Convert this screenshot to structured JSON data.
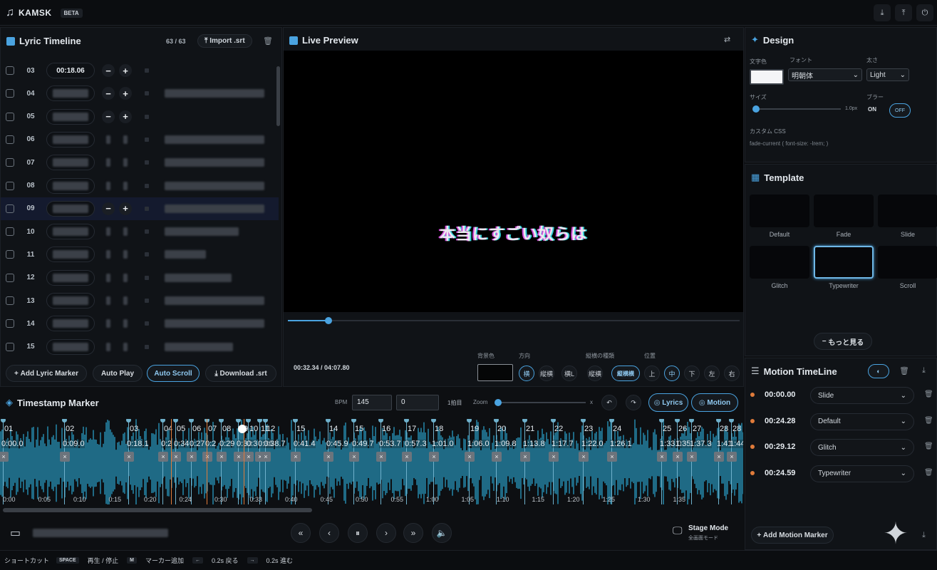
{
  "app": {
    "name": "KAMSK",
    "badge": "BETA"
  },
  "lyric_panel": {
    "title": "Lyric Timeline",
    "count": "63 / 63",
    "import_label": "Import .srt",
    "rows": [
      {
        "num": "03",
        "time": "00:18.06",
        "selected": false
      },
      {
        "num": "04",
        "time": "",
        "selected": false
      },
      {
        "num": "05",
        "time": "",
        "selected": false
      },
      {
        "num": "06",
        "time": "",
        "selected": false
      },
      {
        "num": "07",
        "time": "",
        "selected": false
      },
      {
        "num": "08",
        "time": "",
        "selected": false
      },
      {
        "num": "09",
        "time": "",
        "selected": true
      },
      {
        "num": "10",
        "time": "",
        "selected": false
      },
      {
        "num": "11",
        "time": "",
        "selected": false
      },
      {
        "num": "12",
        "time": "",
        "selected": false
      },
      {
        "num": "13",
        "time": "",
        "selected": false
      },
      {
        "num": "14",
        "time": "",
        "selected": false
      },
      {
        "num": "15",
        "time": "",
        "selected": false
      }
    ],
    "buttons": {
      "add": "Add Lyric Marker",
      "autoplay": "Auto Play",
      "autoscroll": "Auto Scroll",
      "download": "Download .srt"
    }
  },
  "preview": {
    "title": "Live Preview",
    "lyric": "本当にすごい奴らは",
    "time": "00:32.34 / 04:07.80",
    "labels": {
      "bg": "背景色",
      "direction": "方向",
      "transition": "縦横の種類",
      "position": "位置"
    },
    "dir_buttons": [
      "横",
      "縦横",
      "横L",
      "縦横"
    ],
    "trans_label": "縦横1",
    "trans_options": [
      "縦横横"
    ],
    "pos_buttons": [
      "上",
      "中",
      "下",
      "左",
      "右"
    ],
    "progress": 0.09
  },
  "design": {
    "title": "Design",
    "labels": {
      "color": "文字色",
      "font": "フォント",
      "weight": "太さ",
      "size": "サイズ",
      "blur": "ブラー",
      "css": "カスタム CSS"
    },
    "font_value": "明朝体",
    "weight_value": "Light",
    "size_unit": "1.0px",
    "blur_on": "ON",
    "blur_off": "OFF",
    "css_placeholder": "fade-current ( font-size: -lrem; )"
  },
  "template": {
    "title": "Template",
    "items": [
      "Default",
      "Fade",
      "Slide",
      "Glitch",
      "Typewriter",
      "Scroll"
    ],
    "selected": 4,
    "more": "もっと見る"
  },
  "motion": {
    "title": "Motion TimeLine",
    "rows": [
      {
        "time": "00:00.00",
        "effect": "Slide"
      },
      {
        "time": "00:24.28",
        "effect": "Default"
      },
      {
        "time": "00:29.12",
        "effect": "Glitch"
      },
      {
        "time": "00:24.59",
        "effect": "Typewriter"
      }
    ],
    "add": "Add Motion Marker"
  },
  "timestamp": {
    "title": "Timestamp Marker",
    "bpm_label": "BPM",
    "bpm": "145",
    "offset": "0",
    "beat_label": "1拍目",
    "zoom_label": "Zoom",
    "zoom_unit": "x",
    "lyrics_btn": "Lyrics",
    "motion_btn": "Motion",
    "markers": [
      {
        "label": "01",
        "time": "0:00.0"
      },
      {
        "label": "02",
        "time": "0:09.0"
      },
      {
        "label": "03",
        "time": "0:18.1"
      },
      {
        "label": "04",
        "time": "0:2"
      },
      {
        "label": "05",
        "time": "0:34"
      },
      {
        "label": "06",
        "time": "0:27"
      },
      {
        "label": "07",
        "time": "0:2"
      },
      {
        "label": "08",
        "time": "0:29"
      },
      {
        "label": "09",
        "time": "0:30"
      },
      {
        "label": "10",
        "time": "0:3"
      },
      {
        "label": "11",
        "time": "0:36"
      },
      {
        "label": "12",
        "time": "0:38.7"
      },
      {
        "label": "15",
        "time": "0:41.4"
      },
      {
        "label": "14",
        "time": "0:45.9"
      },
      {
        "label": "15",
        "time": "0:49.7"
      },
      {
        "label": "16",
        "time": "0:53.7"
      },
      {
        "label": "17",
        "time": "0:57.3"
      },
      {
        "label": "18",
        "time": "1:01.0"
      },
      {
        "label": "19",
        "time": "1:06.0"
      },
      {
        "label": "20",
        "time": "1:09.8"
      },
      {
        "label": "21",
        "time": "1:13.8"
      },
      {
        "label": "22",
        "time": "1:17.7"
      },
      {
        "label": "23",
        "time": "1:22.0"
      },
      {
        "label": "24",
        "time": "1:26.1"
      },
      {
        "label": "25",
        "time": "1:33.0"
      },
      {
        "label": "26",
        "time": "1:35"
      },
      {
        "label": "27",
        "time": "1:37.3"
      },
      {
        "label": "28",
        "time": "1:41"
      },
      {
        "label": "28",
        "time": "1:44"
      }
    ],
    "ticks": [
      "0:00",
      "0:05",
      "0:10",
      "0:15",
      "0:20",
      "0:24",
      "0:30",
      "0:33",
      "0:40",
      "0:45",
      "0:50",
      "0:55",
      "1:00",
      "1:05",
      "1:10",
      "1:15",
      "1:20",
      "1:25",
      "1:30",
      "1:35"
    ]
  },
  "bottom": {
    "stage_mode": "Stage Mode",
    "stage_sub": "全画面モード"
  },
  "shortcuts": {
    "label": "ショートカット",
    "items": [
      {
        "key": "SPACE",
        "desc": "再生 / 停止"
      },
      {
        "key": "M",
        "desc": "マーカー追加"
      },
      {
        "key": "←",
        "desc": "0.2s 戻る"
      },
      {
        "key": "→",
        "desc": "0.2s 進む"
      }
    ]
  },
  "colors": {
    "accent": "#4aa3e0",
    "wave": "#1f6a85",
    "orange": "#e07b3a"
  }
}
